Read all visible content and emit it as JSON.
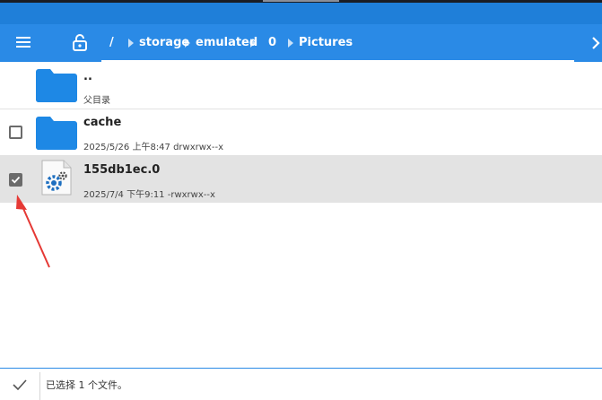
{
  "toolbar": {
    "menu_icon": "hamburger-menu-icon",
    "lock_icon": "lock-open-icon",
    "breadcrumb": [
      "/",
      "storage",
      "emulated",
      "0",
      "Pictures"
    ],
    "more_icon": "chevron-right-icon"
  },
  "files": [
    {
      "name": "..",
      "meta": "父目录",
      "type": "folder",
      "checkbox": null
    },
    {
      "name": "cache",
      "meta": "2025/5/26 上午8:47  drwxrwx--x",
      "type": "folder",
      "checkbox": false
    },
    {
      "name": "155db1ec.0",
      "meta": "2025/7/4 下午9:11  -rwxrwx--x",
      "type": "file",
      "checkbox": true
    }
  ],
  "status": {
    "text": "已选择 1 个文件。",
    "confirm_icon": "checkmark-icon"
  },
  "colors": {
    "accent": "#2a8ae6",
    "folder": "#1e88e5",
    "annotation": "#e53935"
  }
}
